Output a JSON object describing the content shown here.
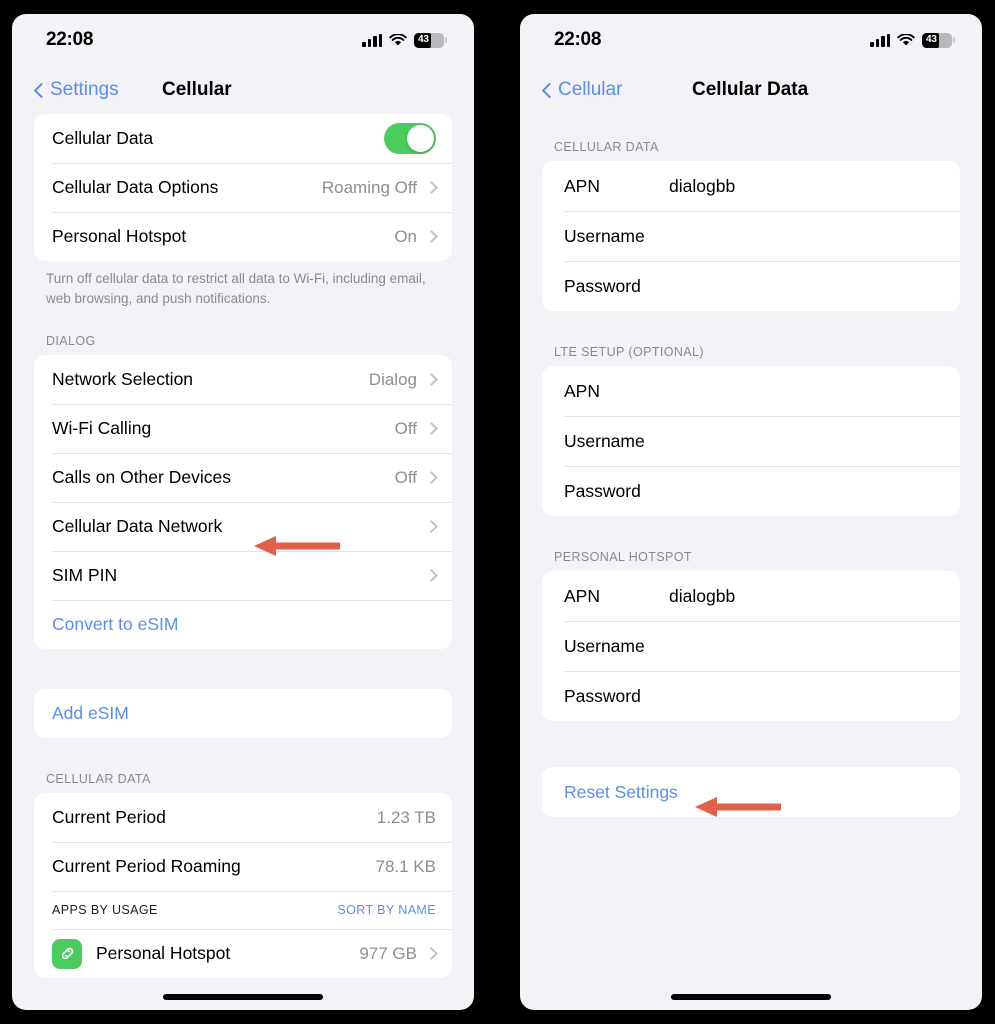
{
  "status_bar": {
    "time": "22:08",
    "battery_percent": "43",
    "signal_icon": "cellular-signal-icon",
    "wifi_icon": "wifi-icon",
    "battery_icon": "battery-icon"
  },
  "colors": {
    "accent_blue": "#5b8def",
    "toggle_green": "#4ccc5f",
    "annotation_red": "#e0604a",
    "page_background": "#f2f2f7",
    "card_background": "#ffffff",
    "secondary_text": "#8e8e93"
  },
  "left_screen": {
    "back_label": "Settings",
    "title": "Cellular",
    "group_main": [
      {
        "label": "Cellular Data",
        "control": "toggle",
        "toggle_on": true
      },
      {
        "label": "Cellular Data Options",
        "value": "Roaming Off",
        "control": "chevron"
      },
      {
        "label": "Personal Hotspot",
        "value": "On",
        "control": "chevron"
      }
    ],
    "footnote": "Turn off cellular data to restrict all data to Wi-Fi, including email, web browsing, and push notifications.",
    "dialog_header": "DIALOG",
    "group_dialog": [
      {
        "label": "Network Selection",
        "value": "Dialog",
        "control": "chevron"
      },
      {
        "label": "Wi-Fi Calling",
        "value": "Off",
        "control": "chevron"
      },
      {
        "label": "Calls on Other Devices",
        "value": "Off",
        "control": "chevron"
      },
      {
        "label": "Cellular Data Network",
        "value": "",
        "control": "chevron",
        "annotated": true
      },
      {
        "label": "SIM PIN",
        "value": "",
        "control": "chevron"
      },
      {
        "label": "Convert to eSIM",
        "value": "",
        "control": "none",
        "link": true
      }
    ],
    "add_esim_label": "Add eSIM",
    "cellular_data_header": "CELLULAR DATA",
    "usage_rows": [
      {
        "label": "Current Period",
        "value": "1.23 TB"
      },
      {
        "label": "Current Period Roaming",
        "value": "78.1 KB"
      }
    ],
    "apps_by_usage_label": "APPS BY USAGE",
    "sort_by_name_label": "SORT BY NAME",
    "app_row": {
      "icon": "personal-hotspot-link-icon",
      "label": "Personal Hotspot",
      "value": "977 GB"
    }
  },
  "right_screen": {
    "back_label": "Cellular",
    "title": "Cellular Data",
    "sections": [
      {
        "header": "CELLULAR DATA",
        "rows": [
          {
            "key": "APN",
            "value": "dialogbb"
          },
          {
            "key": "Username",
            "value": ""
          },
          {
            "key": "Password",
            "value": ""
          }
        ]
      },
      {
        "header": "LTE SETUP (OPTIONAL)",
        "rows": [
          {
            "key": "APN",
            "value": ""
          },
          {
            "key": "Username",
            "value": ""
          },
          {
            "key": "Password",
            "value": ""
          }
        ]
      },
      {
        "header": "PERSONAL HOTSPOT",
        "rows": [
          {
            "key": "APN",
            "value": "dialogbb"
          },
          {
            "key": "Username",
            "value": ""
          },
          {
            "key": "Password",
            "value": ""
          }
        ]
      }
    ],
    "reset_label": "Reset Settings"
  }
}
